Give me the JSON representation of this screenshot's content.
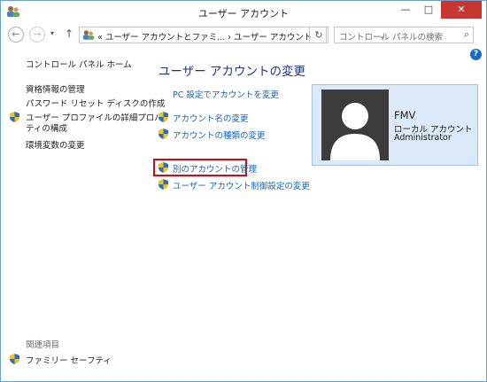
{
  "window": {
    "title": "ユーザー アカウント",
    "minimize_label": "—",
    "maximize_label": "□",
    "close_label": "✕"
  },
  "address_bar": {
    "back_label": "←",
    "forward_label": "→",
    "recent_label": "▾",
    "up_label": "↑",
    "path": "« ユーザー アカウントとファミ... › ユーザー アカウント",
    "dropdown_label": "⌄",
    "refresh_label": "↻",
    "search_placeholder": "コントロール パネルの検索",
    "search_icon": "⌕"
  },
  "help_label": "?",
  "left_nav": {
    "home": "コントロール パネル ホーム",
    "items": [
      "資格情報の管理",
      "パスワード リセット ディスクの作成",
      "ユーザー プロファイルの詳細プロパ",
      "ティの構成",
      "環境変数の変更"
    ],
    "related_title": "関連項目",
    "related_items": [
      "ファミリー セーフティ"
    ]
  },
  "main": {
    "title": "ユーザー アカウントの変更",
    "links": [
      "PC 設定でアカウントを変更",
      "アカウント名の変更",
      "アカウントの種類の変更",
      "別のアカウントの管理",
      "ユーザー アカウント制御設定の変更"
    ]
  },
  "account": {
    "name": "FMV",
    "type": "ローカル アカウント",
    "role": "Administrator"
  },
  "colors": {
    "link": "#1565c0",
    "title": "#1e3287",
    "highlight": "#e60012",
    "tile_bg": "#dce9f8",
    "close_button": "#c7372f"
  },
  "icons": [
    "users-icon",
    "shield-icon",
    "search-icon",
    "refresh-icon",
    "help-icon",
    "user-avatar-icon"
  ]
}
